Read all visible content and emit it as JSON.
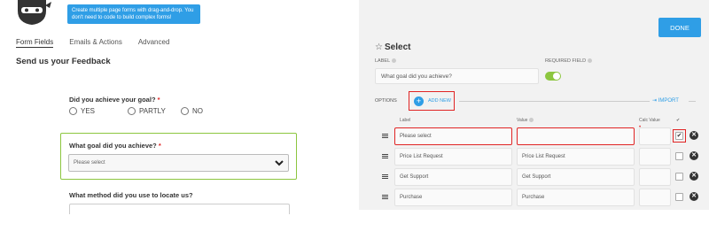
{
  "tooltip": "Create multiple page forms with drag-and-drop. You don't need to code to build complex forms!",
  "tabs": [
    "Form Fields",
    "Emails & Actions",
    "Advanced"
  ],
  "form": {
    "title": "Send us your Feedback",
    "q1": {
      "label": "Did you achieve your goal?",
      "required_mark": "*",
      "options": [
        "YES",
        "PARTLY",
        "NO"
      ]
    },
    "q2": {
      "label": "What goal did you achieve?",
      "required_mark": "*",
      "selected": "Please select"
    },
    "q3": {
      "label": "What method did you use to locate us?"
    }
  },
  "panel": {
    "done_label": "DONE",
    "title": "Select",
    "label_caption": "LABEL",
    "label_value": "What goal did you achieve?",
    "required_caption": "REQUIRED FIELD",
    "required_on": true,
    "options_caption": "OPTIONS",
    "add_new_label": "ADD NEW",
    "import_label": "IMPORT",
    "columns": {
      "label": "Label",
      "value": "Value",
      "calc": "Calc Value",
      "selected": "✔"
    },
    "rows": [
      {
        "label": "Please select",
        "value": "",
        "calc": "",
        "checked": true
      },
      {
        "label": "Price List Request",
        "value": "Price List Request",
        "calc": "",
        "checked": false
      },
      {
        "label": "Get Support",
        "value": "Get Support",
        "calc": "",
        "checked": false
      },
      {
        "label": "Purchase",
        "value": "Purchase",
        "calc": "",
        "checked": false
      }
    ]
  },
  "colors": {
    "accent": "#2f9ee6",
    "toggle_green": "#8cc63f",
    "highlight_red": "#e02424"
  }
}
